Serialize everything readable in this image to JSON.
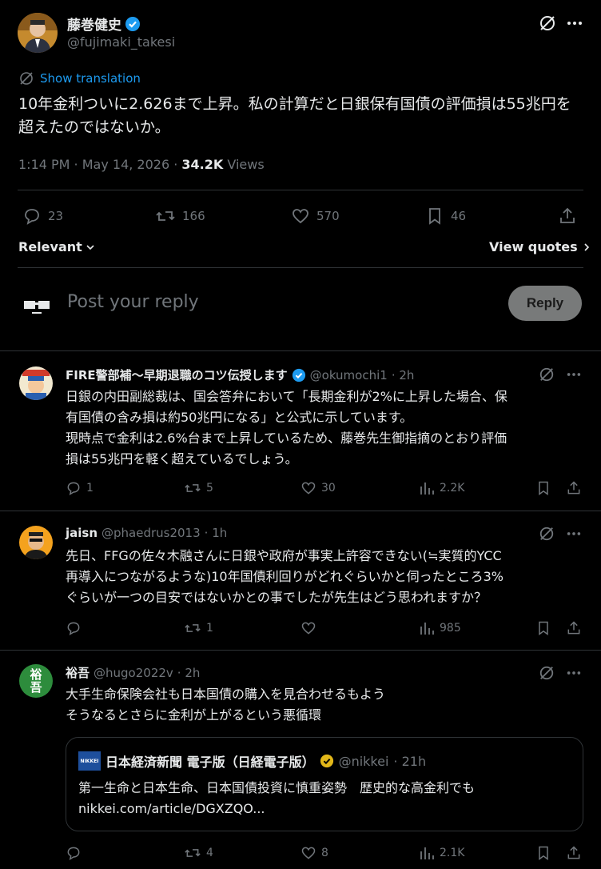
{
  "main": {
    "author_name": "藤巻健史",
    "author_handle": "@fujimaki_takesi",
    "show_translation": "Show translation",
    "text": "10年金利ついに2.626まで上昇。私の計算だと日銀保有国債の評価損は55兆円を超えたのではないか。",
    "time": "1:14 PM · May 14, 2026 · ",
    "views_count": "34.2K",
    "views_label": " Views",
    "replies": "23",
    "reposts": "166",
    "likes": "570",
    "bookmarks": "46"
  },
  "sort": {
    "label": "Relevant",
    "view_quotes": "View quotes"
  },
  "composer": {
    "placeholder": "Post your reply",
    "button": "Reply"
  },
  "replies": [
    {
      "name": "FIRE警部補〜早期退職のコツ伝授します",
      "handle": "@okumochi1",
      "time": "· 2h",
      "text1": "日銀の内田副総裁は、国会答弁において「長期金利が2%に上昇した場合、保",
      "text2": "有国債の含み損は約50兆円になる」と公式に示しています。",
      "text3": "現時点で金利は2.6%台まで上昇しているため、藤巻先生御指摘のとおり評価",
      "text4": "損は55兆円を軽く超えているでしょう。",
      "replies": "1",
      "reposts": "5",
      "likes": "30",
      "views": "2.2K"
    },
    {
      "name": "jaisn",
      "handle": "@phaedrus2013",
      "time": "· 1h",
      "text1": "先日、FFGの佐々木融さんに日銀や政府が事実上許容できない(≒実質的YCC",
      "text2": "再導入につながるような)10年国債利回りがどれぐらいかと伺ったところ3%",
      "text3": "ぐらいが一つの目安ではないかとの事でしたが先生はどう思われますか？",
      "replies": "",
      "reposts": "1",
      "likes": "",
      "views": "985"
    },
    {
      "name": "裕吾",
      "handle": "@hugo2022v",
      "time": "· 2h",
      "avatar_text1": "裕",
      "avatar_text2": "吾",
      "text1": "大手生命保険会社も日本国債の購入を見合わせるもよう",
      "text2": "そうなるとさらに金利が上がるという悪循環",
      "quote_name": "日本経済新聞 電子版（日経電子版）",
      "quote_handle": "@nikkei",
      "quote_time": "· 21h",
      "quote_logo": "NIKKEI",
      "quote_text1": "第一生命と日本生命、日本国債投資に慎重姿勢　歴史的な高金利でも",
      "quote_text2": "nikkei.com/article/DGXZQO...",
      "replies": "",
      "reposts": "4",
      "likes": "8",
      "views": "2.1K"
    }
  ],
  "colors": {
    "accent": "#1d9bf0",
    "muted": "#71767b",
    "text": "#e7e9ea",
    "border": "#2f3336",
    "verified": "#1d9bf0",
    "gold": "#e2b719"
  }
}
